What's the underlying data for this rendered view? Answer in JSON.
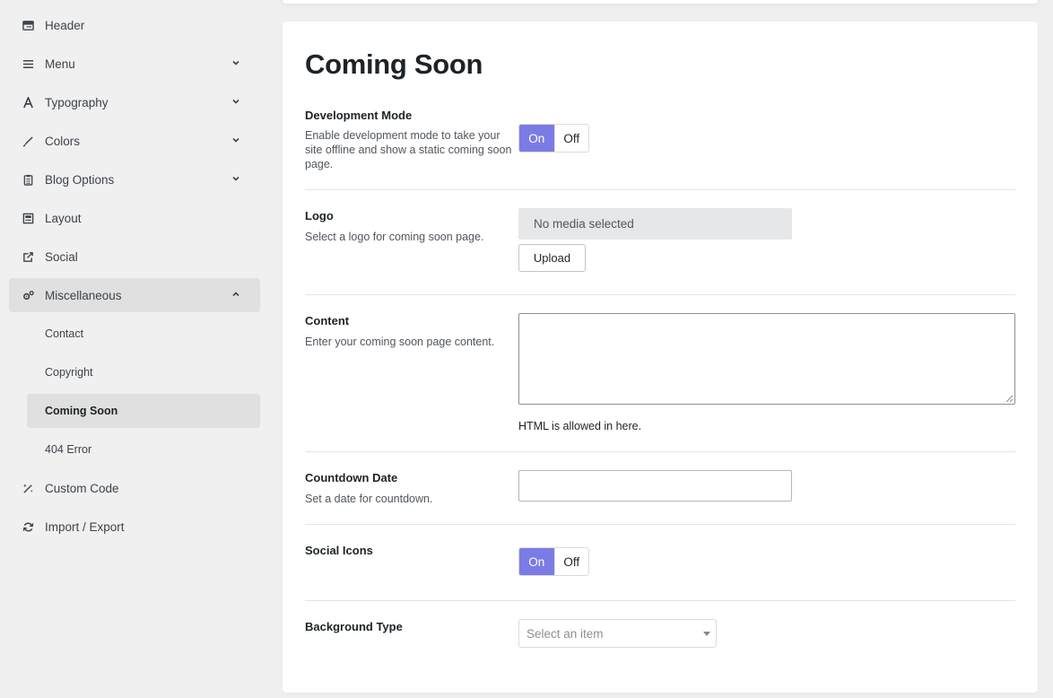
{
  "sidebar": {
    "items": [
      {
        "label": "Header",
        "icon": "header-icon"
      },
      {
        "label": "Menu",
        "icon": "menu-icon"
      },
      {
        "label": "Typography",
        "icon": "typography-icon"
      },
      {
        "label": "Colors",
        "icon": "brush-icon"
      },
      {
        "label": "Blog Options",
        "icon": "clipboard-icon"
      },
      {
        "label": "Layout",
        "icon": "layout-icon"
      },
      {
        "label": "Social",
        "icon": "share-icon"
      },
      {
        "label": "Miscellaneous",
        "icon": "gears-icon"
      },
      {
        "label": "Custom Code",
        "icon": "magic-wand-icon"
      },
      {
        "label": "Import / Export",
        "icon": "refresh-icon"
      }
    ],
    "sub_items": [
      {
        "label": "Contact"
      },
      {
        "label": "Copyright"
      },
      {
        "label": "Coming Soon"
      },
      {
        "label": "404 Error"
      }
    ]
  },
  "main": {
    "title": "Coming Soon",
    "development_mode": {
      "label": "Development Mode",
      "description": "Enable development mode to take your site offline and show a static coming soon page.",
      "on_label": "On",
      "off_label": "Off",
      "value": "On"
    },
    "logo": {
      "label": "Logo",
      "description": "Select a logo for coming soon page.",
      "media_placeholder": "No media selected",
      "upload_label": "Upload"
    },
    "content": {
      "label": "Content",
      "description": "Enter your coming soon page content.",
      "value": "",
      "help": "HTML is allowed in here."
    },
    "countdown": {
      "label": "Countdown Date",
      "description": "Set a date for countdown.",
      "value": ""
    },
    "social_icons": {
      "label": "Social Icons",
      "on_label": "On",
      "off_label": "Off",
      "value": "On"
    },
    "background_type": {
      "label": "Background Type",
      "placeholder": "Select an item"
    }
  },
  "colors": {
    "accent": "#7b7be6",
    "sidebar_bg": "#f0f0f1",
    "active_bg": "#e0e0e0"
  }
}
